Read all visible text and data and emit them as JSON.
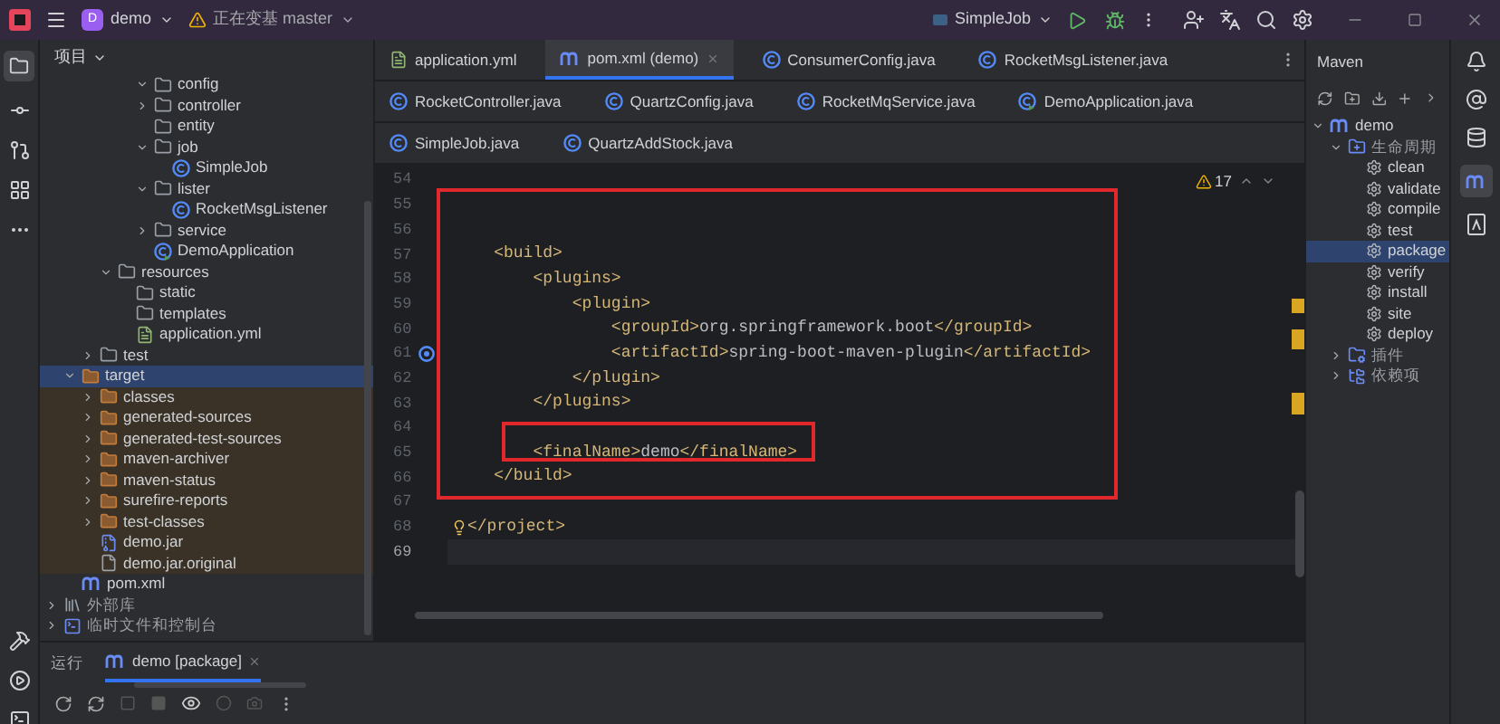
{
  "title_bar": {
    "project_badge": "D",
    "project": "demo",
    "branch_status": "正在变基 master",
    "run_config": "SimpleJob"
  },
  "project_panel": {
    "title": "项目",
    "tree": [
      {
        "children": [
          {
            "children": [
              {
                "children": [
                  {
                    "children": [
                      {
                        "children": [
                          {
                            "label": "config",
                            "kind": "folder",
                            "expanded": true
                          },
                          {
                            "label": "controller",
                            "kind": "folder",
                            "expanded": false
                          },
                          {
                            "label": "entity",
                            "kind": "folder"
                          },
                          {
                            "label": "job",
                            "kind": "folder",
                            "expanded": true,
                            "children": [
                              {
                                "label": "SimpleJob",
                                "kind": "class"
                              }
                            ]
                          },
                          {
                            "label": "lister",
                            "kind": "folder",
                            "expanded": true,
                            "children": [
                              {
                                "label": "RocketMsgListener",
                                "kind": "class"
                              }
                            ]
                          },
                          {
                            "label": "service",
                            "kind": "folder",
                            "expanded": false
                          },
                          {
                            "label": "DemoApplication",
                            "kind": "main-class"
                          }
                        ]
                      }
                    ]
                  },
                  {
                    "label": "resources",
                    "kind": "folder",
                    "expanded": true,
                    "children": [
                      {
                        "label": "static",
                        "kind": "folder"
                      },
                      {
                        "label": "templates",
                        "kind": "folder"
                      },
                      {
                        "label": "application.yml",
                        "kind": "yml"
                      }
                    ]
                  }
                ]
              },
              {
                "label": "test",
                "kind": "folder",
                "expanded": false
              }
            ]
          },
          {
            "label": "target",
            "kind": "excluded-folder",
            "expanded": true,
            "selected": true,
            "children": [
              {
                "label": "classes",
                "kind": "excluded-folder",
                "expanded": false,
                "selected": false
              },
              {
                "label": "generated-sources",
                "kind": "excluded-folder",
                "expanded": false,
                "selected": false
              },
              {
                "label": "generated-test-sources",
                "kind": "excluded-folder",
                "expanded": false,
                "selected": false
              },
              {
                "label": "maven-archiver",
                "kind": "excluded-folder",
                "expanded": false,
                "selected": false
              },
              {
                "label": "maven-status",
                "kind": "excluded-folder",
                "expanded": false,
                "selected": false
              },
              {
                "label": "surefire-reports",
                "kind": "excluded-folder",
                "expanded": false,
                "selected": false
              },
              {
                "label": "test-classes",
                "kind": "excluded-folder",
                "expanded": false,
                "selected": false
              },
              {
                "label": "demo.jar",
                "kind": "jar",
                "selected": false
              },
              {
                "label": "demo.jar.original",
                "kind": "file",
                "selected": false
              }
            ]
          },
          {
            "label": "pom.xml",
            "kind": "maven"
          }
        ]
      },
      {
        "label": "外部库",
        "kind": "library",
        "expanded": false
      },
      {
        "label": "临时文件和控制台",
        "kind": "scratch",
        "expanded": false
      }
    ]
  },
  "editor_tabs": [
    [
      {
        "label": "application.yml",
        "kind": "yml",
        "selected": false
      },
      {
        "label": "pom.xml (demo)",
        "kind": "maven",
        "selected": true
      },
      {
        "label": "ConsumerConfig.java",
        "kind": "class",
        "selected": false
      },
      {
        "label": "RocketMsgListener.java",
        "kind": "class",
        "selected": false
      }
    ],
    [
      {
        "label": "RocketController.java",
        "kind": "class",
        "selected": false
      },
      {
        "label": "QuartzConfig.java",
        "kind": "class",
        "selected": false
      },
      {
        "label": "RocketMqService.java",
        "kind": "class",
        "selected": false
      },
      {
        "label": "DemoApplication.java",
        "kind": "main-class",
        "selected": false
      }
    ],
    [
      {
        "label": "SimpleJob.java",
        "kind": "class",
        "selected": false
      },
      {
        "label": "QuartzAddStock.java",
        "kind": "class",
        "selected": false
      }
    ]
  ],
  "editor": {
    "warning_count": "17",
    "lines": [
      {
        "number": "54",
        "current": false
      },
      {
        "number": "55",
        "current": false
      },
      {
        "number": "56",
        "current": false
      },
      {
        "number": "57",
        "text": "    <build>",
        "current": false
      },
      {
        "number": "58",
        "text": "        <plugins>",
        "current": false
      },
      {
        "number": "59",
        "text": "            <plugin>",
        "current": false
      },
      {
        "number": "60",
        "text": "                <groupId>org.springframework.boot</groupId>",
        "current": false
      },
      {
        "number": "61",
        "text": "                <artifactId>spring-boot-maven-plugin</artifactId>",
        "current": false,
        "kind": "bean"
      },
      {
        "number": "62",
        "text": "            </plugin>",
        "current": false
      },
      {
        "number": "63",
        "text": "        </plugins>",
        "current": false
      },
      {
        "number": "64",
        "current": false
      },
      {
        "number": "65",
        "text": "        <finalName>demo</finalName>",
        "current": false
      },
      {
        "number": "66",
        "text": "    </build>",
        "current": false
      },
      {
        "number": "67",
        "current": false
      },
      {
        "number": "68",
        "text": "</project>",
        "current": false,
        "kind": "hint"
      },
      {
        "number": "69",
        "current": true
      }
    ]
  },
  "maven_panel": {
    "title": "Maven",
    "tree": [
      {
        "label": "demo",
        "kind": "project",
        "expanded": true,
        "children": [
          {
            "label": "生命周期",
            "kind": "lifecycle",
            "expanded": true,
            "children": [
              {
                "label": "clean",
                "kind": "goal",
                "selected": false
              },
              {
                "label": "validate",
                "kind": "goal",
                "selected": false
              },
              {
                "label": "compile",
                "kind": "goal",
                "selected": false
              },
              {
                "label": "test",
                "kind": "goal",
                "selected": false
              },
              {
                "label": "package",
                "kind": "goal",
                "selected": true
              },
              {
                "label": "verify",
                "kind": "goal",
                "selected": false
              },
              {
                "label": "install",
                "kind": "goal",
                "selected": false
              },
              {
                "label": "site",
                "kind": "goal",
                "selected": false
              },
              {
                "label": "deploy",
                "kind": "goal",
                "selected": false
              }
            ]
          },
          {
            "label": "插件",
            "kind": "plugins",
            "expanded": false
          },
          {
            "label": "依赖项",
            "kind": "dependencies",
            "expanded": false
          }
        ]
      }
    ]
  },
  "run_panel": {
    "tabs": [
      {
        "label": "运行",
        "kind": "title",
        "selected": false
      },
      {
        "label": "demo [package]",
        "kind": "run",
        "selected": true
      }
    ]
  }
}
